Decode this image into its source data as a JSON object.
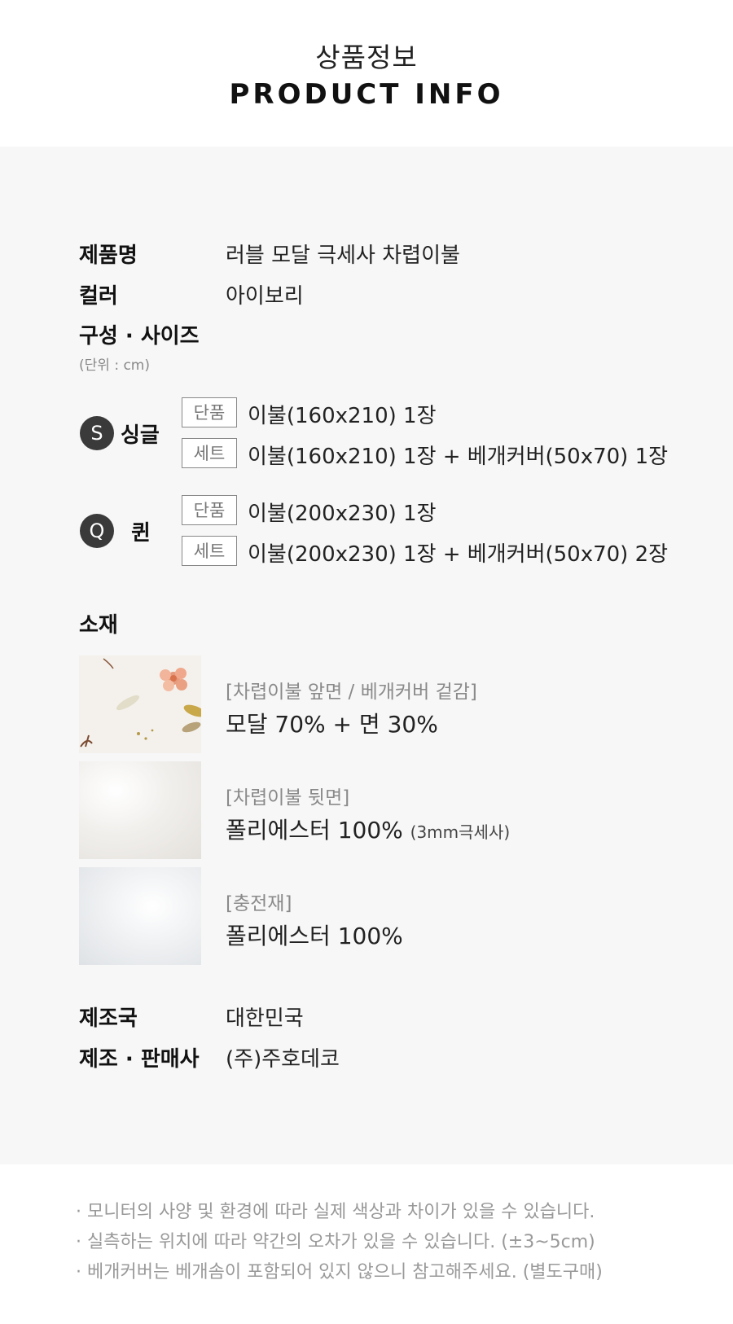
{
  "header": {
    "title_ko": "상품정보",
    "title_en": "PRODUCT INFO"
  },
  "product": {
    "name_label": "제품명",
    "name_value": "러블 모달 극세사 차렵이불",
    "color_label": "컬러",
    "color_value": "아이보리",
    "composition_label": "구성 · 사이즈",
    "unit_note": "(단위 : cm)"
  },
  "sizes": [
    {
      "badge": "S",
      "name": "싱글",
      "options": [
        {
          "tag": "단품",
          "desc": "이불(160x210) 1장"
        },
        {
          "tag": "세트",
          "desc": "이불(160x210) 1장 + 베개커버(50x70) 1장"
        }
      ]
    },
    {
      "badge": "Q",
      "name": "퀸",
      "options": [
        {
          "tag": "단품",
          "desc": "이불(200x230) 1장"
        },
        {
          "tag": "세트",
          "desc": "이불(200x230) 1장 + 베개커버(50x70) 2장"
        }
      ]
    }
  ],
  "material": {
    "label": "소재",
    "items": [
      {
        "caption": "[차렵이불 앞면 / 베개커버 겉감]",
        "value": "모달 70% + 면 30%",
        "note": ""
      },
      {
        "caption": "[차렵이불 뒷면]",
        "value": "폴리에스터 100%",
        "note": "(3mm극세사)"
      },
      {
        "caption": "[충전재]",
        "value": "폴리에스터 100%",
        "note": ""
      }
    ]
  },
  "origin": {
    "country_label": "제조국",
    "country_value": "대한민국",
    "maker_label": "제조 · 판매사",
    "maker_value": "(주)주호데코"
  },
  "notes": [
    "· 모니터의 사양 및 환경에 따라 실제 색상과 차이가 있을 수 있습니다.",
    "· 실측하는 위치에 따라 약간의 오차가 있을 수 있습니다. (±3~5cm)",
    "· 베개커버는 베개솜이 포함되어 있지 않으니 참고해주세요. (별도구매)"
  ]
}
